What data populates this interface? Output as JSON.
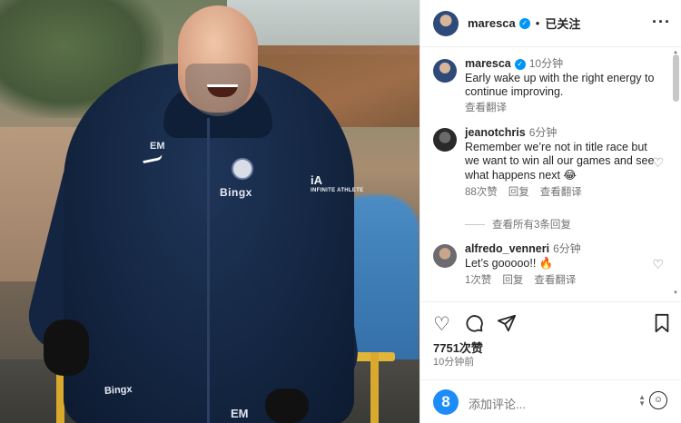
{
  "post": {
    "username": "maresca",
    "header_separator": "•",
    "follow_status": "已关注",
    "more_icon": "more-horizontal-icon"
  },
  "caption": {
    "username": "maresca",
    "time": "10分钟",
    "text": "Early wake up with the right energy to continue improving.",
    "translate": "查看翻译"
  },
  "comments": [
    {
      "username": "jeanotchris",
      "time": "6分钟",
      "text": "Remember we’re not in title race but we want to win all our games and see what happens next 😂",
      "likes": "88次赞",
      "reply": "回复",
      "translate": "查看翻译",
      "view_replies": "查看所有3条回复"
    },
    {
      "username": "alfredo_venneri",
      "time": "6分钟",
      "text": "Let’s gooooo!! 🔥",
      "likes": "1次赞",
      "reply": "回复",
      "translate": "查看翻译"
    }
  ],
  "actions": {
    "like_icon": "heart-icon",
    "comment_icon": "comment-icon",
    "share_icon": "send-icon",
    "save_icon": "bookmark-icon",
    "likes_count": "7751次赞",
    "posted_ago": "10分钟前"
  },
  "add_comment": {
    "avatar_letter": "8",
    "placeholder": "添加评论..."
  },
  "photo": {
    "sponsor": "Bingx",
    "initials": "EM",
    "partner": "iA",
    "partner_sub": "INFINITE ATHLETE"
  },
  "colors": {
    "verified": "#0095f6",
    "jacket": "#142642",
    "rail": "#e1b53a"
  }
}
